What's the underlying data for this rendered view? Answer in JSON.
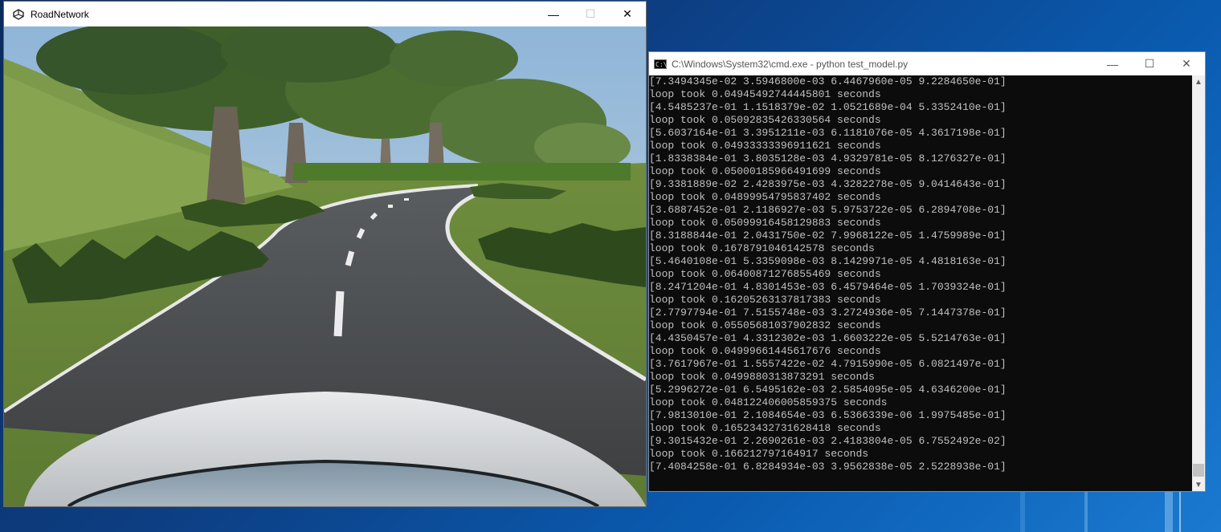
{
  "game_window": {
    "title": "RoadNetwork",
    "icon": "unity-icon",
    "minimize": "—",
    "maximize": "☐",
    "close": "✕"
  },
  "cmd_window": {
    "title": "C:\\Windows\\System32\\cmd.exe - python  test_model.py",
    "icon": "cmd-icon",
    "minimize": "—",
    "maximize": "☐",
    "close": "✕",
    "lines": [
      "[7.3494345e-02 3.5946800e-03 6.4467960e-05 9.2284650e-01]",
      "loop took 0.04945492744445801 seconds",
      "[4.5485237e-01 1.1518379e-02 1.0521689e-04 5.3352410e-01]",
      "loop took 0.05092835426330564 seconds",
      "[5.6037164e-01 3.3951211e-03 6.1181076e-05 4.3617198e-01]",
      "loop took 0.04933333396911621 seconds",
      "[1.8338384e-01 3.8035128e-03 4.9329781e-05 8.1276327e-01]",
      "loop took 0.05000185966491699 seconds",
      "[9.3381889e-02 2.4283975e-03 4.3282278e-05 9.0414643e-01]",
      "loop took 0.04899954795837402 seconds",
      "[3.6887452e-01 2.1186927e-03 5.9753722e-05 6.2894708e-01]",
      "loop took 0.05099916458129883 seconds",
      "[8.3188844e-01 2.0431750e-02 7.9968122e-05 1.4759989e-01]",
      "loop took 0.1678791046142578 seconds",
      "[5.4640108e-01 5.3359098e-03 8.1429971e-05 4.4818163e-01]",
      "loop took 0.06400871276855469 seconds",
      "[8.2471204e-01 4.8301453e-03 6.4579464e-05 1.7039324e-01]",
      "loop took 0.16205263137817383 seconds",
      "[2.7797794e-01 7.5155748e-03 3.2724936e-05 7.1447378e-01]",
      "loop took 0.05505681037902832 seconds",
      "[4.4350457e-01 4.3312302e-03 1.6603222e-05 5.5214763e-01]",
      "loop took 0.04999661445617676 seconds",
      "[3.7617967e-01 1.5557422e-02 4.7915990e-05 6.0821497e-01]",
      "loop took 0.0499880313873291 seconds",
      "[5.2996272e-01 6.5495162e-03 2.5854095e-05 4.6346200e-01]",
      "loop took 0.048122406005859375 seconds",
      "[7.9813010e-01 2.1084654e-03 6.5366339e-06 1.9975485e-01]",
      "loop took 0.16523432731628418 seconds",
      "[9.3015432e-01 2.2690261e-03 2.4183804e-05 6.7552492e-02]",
      "loop took 0.166212797164917 seconds",
      "[7.4084258e-01 6.8284934e-03 3.9562838e-05 2.5228938e-01]"
    ]
  }
}
